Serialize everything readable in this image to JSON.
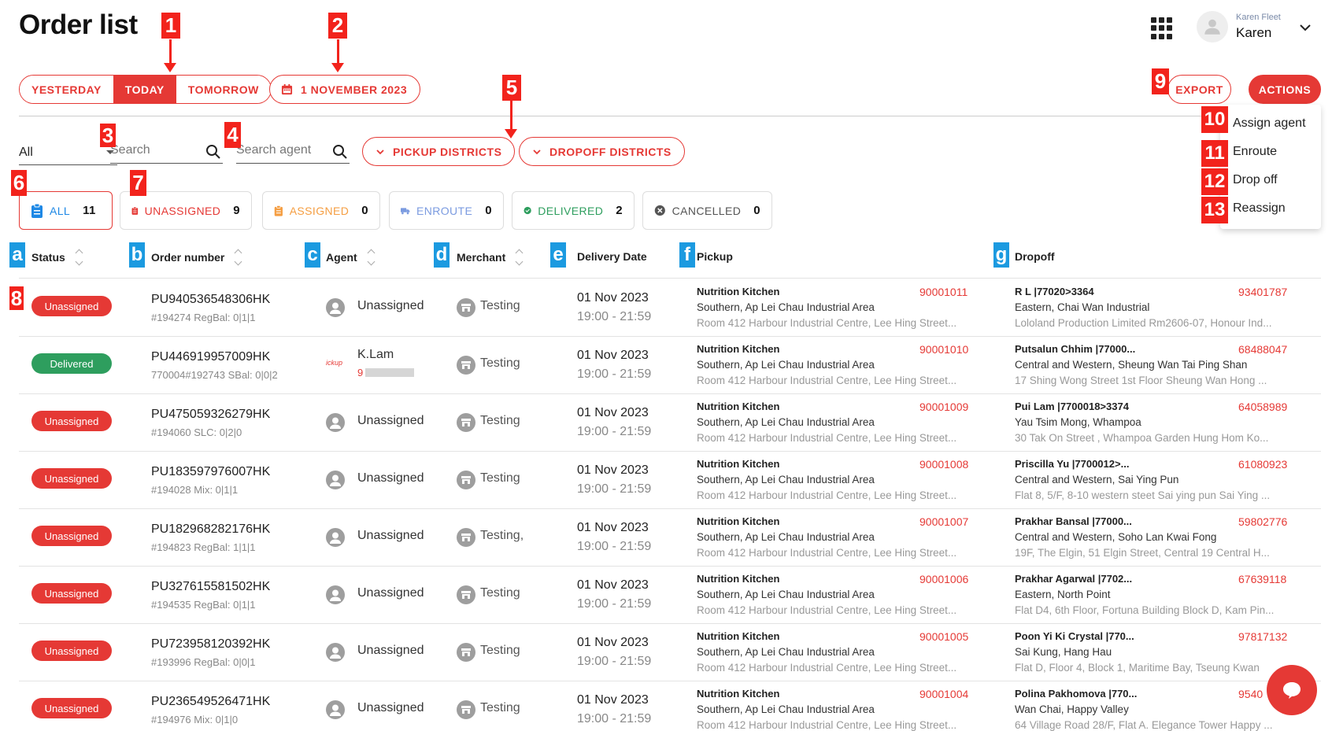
{
  "page_title": "Order list",
  "user": {
    "subtitle": "Karen Fleet",
    "name": "Karen"
  },
  "date_tabs": [
    {
      "label": "YESTERDAY",
      "active": false
    },
    {
      "label": "TODAY",
      "active": true
    },
    {
      "label": "TOMORROW",
      "active": false
    }
  ],
  "date_picker": {
    "label": "1 NOVEMBER 2023"
  },
  "toolbar": {
    "export_label": "EXPORT",
    "actions_label": "ACTIONS"
  },
  "actions_menu": [
    "Assign agent",
    "Enroute",
    "Drop off",
    "Reassign"
  ],
  "filters": {
    "status_select": "All",
    "search_placeholder": "Search",
    "agent_placeholder": "Search agent",
    "pickup_districts": "PICKUP DISTRICTS",
    "dropoff_districts": "DROPOFF DISTRICTS"
  },
  "status_cards": [
    {
      "label": "ALL",
      "count": "11",
      "color": "#1e88e5",
      "icon": "clipboard-icon"
    },
    {
      "label": "UNASSIGNED",
      "count": "9",
      "color": "#e53935",
      "icon": "clipboard-icon"
    },
    {
      "label": "ASSIGNED",
      "count": "0",
      "color": "#f59e42",
      "icon": "clipboard-icon"
    },
    {
      "label": "ENROUTE",
      "count": "0",
      "color": "#7b9be0",
      "icon": "truck-icon"
    },
    {
      "label": "DELIVERED",
      "count": "2",
      "color": "#2e9e5e",
      "icon": "check-circle-icon"
    },
    {
      "label": "CANCELLED",
      "count": "0",
      "color": "#555555",
      "icon": "x-circle-icon"
    }
  ],
  "table": {
    "headers": [
      "Status",
      "Order number",
      "Agent",
      "Merchant",
      "Delivery Date",
      "Pickup",
      "Dropoff"
    ],
    "rows": [
      {
        "status": "Unassigned",
        "status_color": "#e53935",
        "order": "PU940536548306HK",
        "sub": "#194274 RegBal: 0|1|1",
        "agent": "Unassigned",
        "merchant": "Testing",
        "date": "01 Nov 2023",
        "time": "19:00 - 21:59",
        "pickup_name": "Nutrition Kitchen",
        "pickup_phone": "90001011",
        "pickup_area": "Southern, Ap Lei Chau Industrial Area",
        "pickup_addr": "Room 412 Harbour Industrial Centre, Lee Hing Street...",
        "drop_name": "R L |77020>3364",
        "drop_phone": "93401787",
        "drop_area": "Eastern, Chai Wan Industrial",
        "drop_addr": "Lololand Production Limited Rm2606-07, Honour Ind..."
      },
      {
        "status": "Delivered",
        "status_color": "#2e9e5e",
        "order": "PU446919957009HK",
        "sub": "770004#192743 SBal: 0|0|2",
        "agent": "K.Lam",
        "agent_logo": "ickup",
        "agent_phone": "9",
        "merchant": "Testing",
        "date": "01 Nov 2023",
        "time": "19:00 - 21:59",
        "pickup_name": "Nutrition Kitchen",
        "pickup_phone": "90001010",
        "pickup_area": "Southern, Ap Lei Chau Industrial Area",
        "pickup_addr": "Room 412 Harbour Industrial Centre, Lee Hing Street...",
        "drop_name": "Putsalun Chhim |77000...",
        "drop_phone": "68488047",
        "drop_area": "Central and Western, Sheung Wan Tai Ping Shan",
        "drop_addr": "17 Shing Wong Street 1st Floor Sheung Wan Hong ..."
      },
      {
        "status": "Unassigned",
        "status_color": "#e53935",
        "order": "PU475059326279HK",
        "sub": "#194060 SLC: 0|2|0",
        "agent": "Unassigned",
        "merchant": "Testing",
        "date": "01 Nov 2023",
        "time": "19:00 - 21:59",
        "pickup_name": "Nutrition Kitchen",
        "pickup_phone": "90001009",
        "pickup_area": "Southern, Ap Lei Chau Industrial Area",
        "pickup_addr": "Room 412 Harbour Industrial Centre, Lee Hing Street...",
        "drop_name": "Pui Lam |7700018>3374",
        "drop_phone": "64058989",
        "drop_area": "Yau Tsim Mong, Whampoa",
        "drop_addr": "30 Tak On Street , Whampoa Garden Hung Hom Ko..."
      },
      {
        "status": "Unassigned",
        "status_color": "#e53935",
        "order": "PU183597976007HK",
        "sub": "#194028 Mix: 0|1|1",
        "agent": "Unassigned",
        "merchant": "Testing",
        "date": "01 Nov 2023",
        "time": "19:00 - 21:59",
        "pickup_name": "Nutrition Kitchen",
        "pickup_phone": "90001008",
        "pickup_area": "Southern, Ap Lei Chau Industrial Area",
        "pickup_addr": "Room 412 Harbour Industrial Centre, Lee Hing Street...",
        "drop_name": "Priscilla Yu |7700012>...",
        "drop_phone": "61080923",
        "drop_area": "Central and Western, Sai Ying Pun",
        "drop_addr": "Flat 8, 5/F, 8-10 western steet Sai ying pun Sai Ying ..."
      },
      {
        "status": "Unassigned",
        "status_color": "#e53935",
        "order": "PU182968282176HK",
        "sub": "#194823 RegBal: 1|1|1",
        "agent": "Unassigned",
        "merchant": "Testing,",
        "date": "01 Nov 2023",
        "time": "19:00 - 21:59",
        "pickup_name": "Nutrition Kitchen",
        "pickup_phone": "90001007",
        "pickup_area": "Southern, Ap Lei Chau Industrial Area",
        "pickup_addr": "Room 412 Harbour Industrial Centre, Lee Hing Street...",
        "drop_name": "Prakhar Bansal |77000...",
        "drop_phone": "59802776",
        "drop_area": "Central and Western, Soho Lan Kwai Fong",
        "drop_addr": "19F, The Elgin, 51 Elgin Street, Central 19 Central H..."
      },
      {
        "status": "Unassigned",
        "status_color": "#e53935",
        "order": "PU327615581502HK",
        "sub": "#194535 RegBal: 0|1|1",
        "agent": "Unassigned",
        "merchant": "Testing",
        "date": "01 Nov 2023",
        "time": "19:00 - 21:59",
        "pickup_name": "Nutrition Kitchen",
        "pickup_phone": "90001006",
        "pickup_area": "Southern, Ap Lei Chau Industrial Area",
        "pickup_addr": "Room 412 Harbour Industrial Centre, Lee Hing Street...",
        "drop_name": "Prakhar Agarwal |7702...",
        "drop_phone": "67639118",
        "drop_area": "Eastern, North Point",
        "drop_addr": "Flat D4, 6th Floor, Fortuna Building Block D, Kam Pin..."
      },
      {
        "status": "Unassigned",
        "status_color": "#e53935",
        "order": "PU723958120392HK",
        "sub": "#193996 RegBal: 0|0|1",
        "agent": "Unassigned",
        "merchant": "Testing",
        "date": "01 Nov 2023",
        "time": "19:00 - 21:59",
        "pickup_name": "Nutrition Kitchen",
        "pickup_phone": "90001005",
        "pickup_area": "Southern, Ap Lei Chau Industrial Area",
        "pickup_addr": "Room 412 Harbour Industrial Centre, Lee Hing Street...",
        "drop_name": "Poon Yi Ki Crystal |770...",
        "drop_phone": "97817132",
        "drop_area": "Sai Kung, Hang Hau",
        "drop_addr": "Flat D, Floor 4, Block 1, Maritime Bay, Tseung Kwan"
      },
      {
        "status": "Unassigned",
        "status_color": "#e53935",
        "order": "PU236549526471HK",
        "sub": "#194976 Mix: 0|1|0",
        "agent": "Unassigned",
        "merchant": "Testing",
        "date": "01 Nov 2023",
        "time": "19:00 - 21:59",
        "pickup_name": "Nutrition Kitchen",
        "pickup_phone": "90001004",
        "pickup_area": "Southern, Ap Lei Chau Industrial Area",
        "pickup_addr": "Room 412 Harbour Industrial Centre, Lee Hing Street...",
        "drop_name": "Polina Pakhomova |770...",
        "drop_phone": "9540",
        "drop_area": "Wan Chai, Happy Valley",
        "drop_addr": "64 Village Road 28/F, Flat A. Elegance Tower Happy ..."
      }
    ]
  },
  "annotations": {
    "numbers": [
      "1",
      "2",
      "3",
      "4",
      "5",
      "6",
      "7",
      "8",
      "9",
      "10",
      "11",
      "12",
      "13"
    ],
    "letters": [
      "a",
      "b",
      "c",
      "d",
      "e",
      "f",
      "g"
    ]
  },
  "colors": {
    "accent": "#e53935",
    "annotation_red": "#f2231c",
    "annotation_blue": "#1b9ae0"
  }
}
